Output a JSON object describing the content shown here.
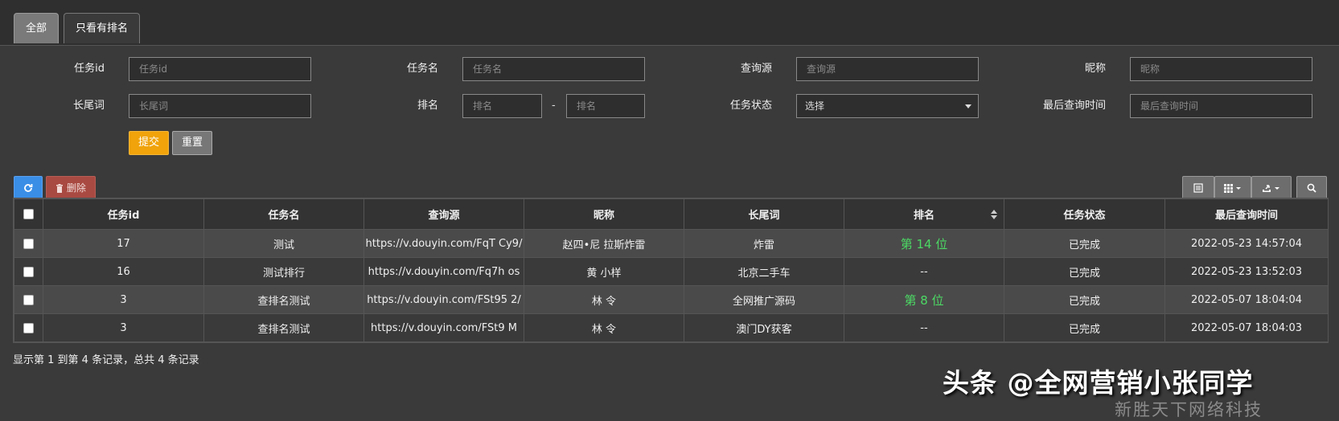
{
  "tabs": [
    {
      "label": "全部",
      "active": true
    },
    {
      "label": "只看有排名",
      "active": false
    }
  ],
  "filters": {
    "task_id": {
      "label": "任务id",
      "placeholder": "任务id"
    },
    "task_name": {
      "label": "任务名",
      "placeholder": "任务名"
    },
    "query_source": {
      "label": "查询源",
      "placeholder": "查询源"
    },
    "nickname": {
      "label": "昵称",
      "placeholder": "昵称"
    },
    "long_tail": {
      "label": "长尾词",
      "placeholder": "长尾词"
    },
    "rank": {
      "label": "排名",
      "placeholder_min": "排名",
      "placeholder_max": "排名",
      "separator": "-"
    },
    "task_status": {
      "label": "任务状态",
      "selected": "选择"
    },
    "last_query_time": {
      "label": "最后查询时间",
      "placeholder": "最后查询时间"
    }
  },
  "buttons": {
    "submit": "提交",
    "reset": "重置",
    "delete": "删除"
  },
  "toolbar_icons": [
    "refresh-icon",
    "trash-icon",
    "list-icon",
    "grid-icon",
    "export-icon",
    "search-icon"
  ],
  "table": {
    "headers": {
      "task_id": "任务id",
      "task_name": "任务名",
      "query_source": "查询源",
      "nickname": "昵称",
      "long_tail": "长尾词",
      "rank": "排名",
      "status": "任务状态",
      "last_query": "最后查询时间"
    },
    "rows": [
      {
        "task_id": "17",
        "task_name": "测试",
        "query_source": "https://v.douyin.com/FqT Cy9/",
        "nickname": "赵四•尼 拉斯炸雷",
        "long_tail": "炸雷",
        "rank": "第 14 位",
        "status": "已完成",
        "last_query": "2022-05-23 14:57:04"
      },
      {
        "task_id": "16",
        "task_name": "测试排行",
        "query_source": "https://v.douyin.com/Fq7h  os",
        "nickname": "黄 小样",
        "long_tail": "北京二手车",
        "rank": "--",
        "status": "已完成",
        "last_query": "2022-05-23 13:52:03"
      },
      {
        "task_id": "3",
        "task_name": "查排名测试",
        "query_source": "https://v.douyin.com/FSt95  2/",
        "nickname": "林 令",
        "long_tail": "全网推广源码",
        "rank": "第 8 位",
        "status": "已完成",
        "last_query": "2022-05-07 18:04:04"
      },
      {
        "task_id": "3",
        "task_name": "查排名测试",
        "query_source": "https://v.douyin.com/FSt9  M",
        "nickname": "林 令",
        "long_tail": "澳门DY获客",
        "rank": "--",
        "status": "已完成",
        "last_query": "2022-05-07 18:04:03"
      }
    ]
  },
  "pagination": {
    "summary": "显示第 1 到第 4 条记录，总共 4 条记录"
  },
  "watermark": {
    "main": "头条 @全网营销小张同学",
    "sub": "新胜天下网络科技"
  },
  "colors": {
    "rank_highlight": "#4cd964",
    "submit": "#f0a30a",
    "refresh": "#3a8ee6",
    "delete": "#a94a42"
  }
}
